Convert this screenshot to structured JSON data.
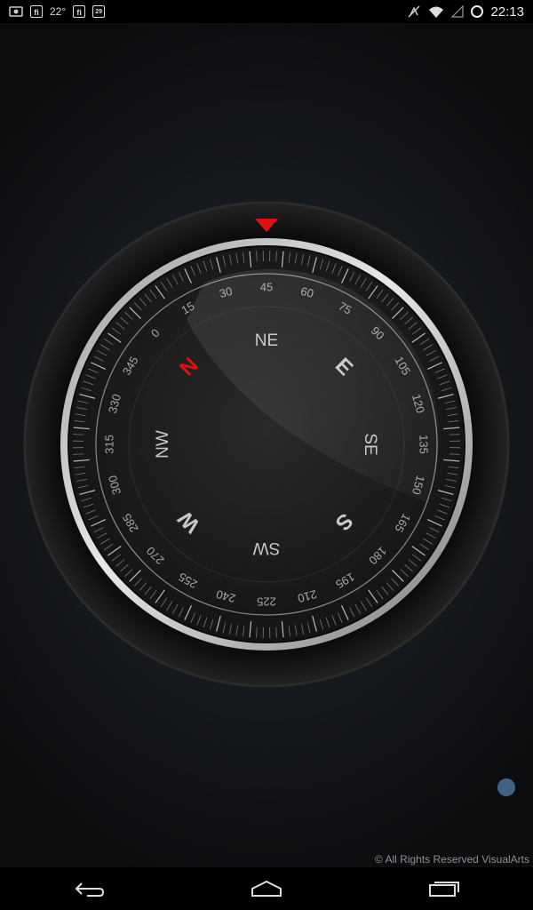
{
  "status_bar": {
    "left_icons": [
      "screenshot-icon",
      "flipboard-icon",
      "flipboard-icon",
      "calendar-icon"
    ],
    "badge_letter": "fi",
    "temperature": "22°",
    "calendar_number": "29",
    "right_icons": [
      "mute-icon",
      "wifi-icon",
      "signal-icon",
      "sync-ring-icon"
    ],
    "time": "22:13"
  },
  "compass": {
    "heading_marker_color": "#e01010",
    "north_color": "#e01010",
    "cardinals": [
      {
        "label": "N",
        "bearing": 0,
        "highlight": true
      },
      {
        "label": "NE",
        "bearing": 45
      },
      {
        "label": "E",
        "bearing": 90
      },
      {
        "label": "SE",
        "bearing": 135
      },
      {
        "label": "S",
        "bearing": 180
      },
      {
        "label": "SW",
        "bearing": 225
      },
      {
        "label": "W",
        "bearing": 270
      },
      {
        "label": "NW",
        "bearing": 315
      }
    ],
    "degree_labels": [
      "0",
      "15",
      "30",
      "45",
      "60",
      "75",
      "90",
      "105",
      "120",
      "135",
      "150",
      "165",
      "180",
      "195",
      "210",
      "225",
      "240",
      "255",
      "270",
      "285",
      "300",
      "315",
      "330",
      "345"
    ]
  },
  "footer": {
    "copyright": "© All Rights Reserved VisualArts"
  },
  "indicator_color": "#3f6482",
  "nav_bar": {
    "buttons": [
      "back-icon",
      "home-icon",
      "recent-apps-icon"
    ]
  }
}
